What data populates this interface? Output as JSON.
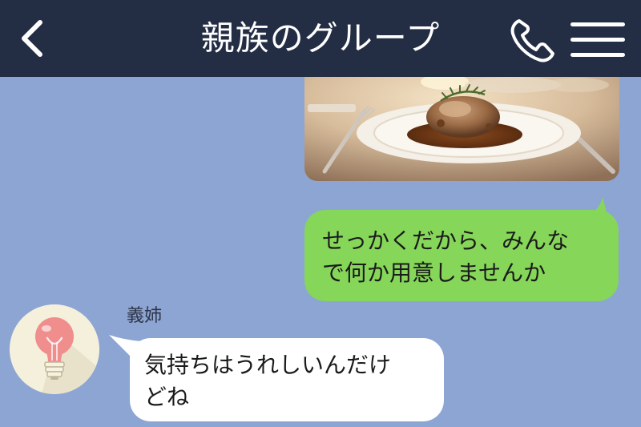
{
  "header": {
    "title": "親族のグループ",
    "background": "#232d44",
    "back_icon": "chevron-left-icon",
    "call_icon": "phone-icon",
    "menu_icon": "hamburger-menu-icon"
  },
  "chat": {
    "background": "#8da5d3",
    "messages": [
      {
        "direction": "outgoing",
        "type": "image",
        "image_content": "plated roasted chicken with rosemary on restaurant dinner table"
      },
      {
        "direction": "outgoing",
        "type": "text",
        "text": "せっかくだから、みんな\nで何か用意しませんか",
        "bubble_color": "#86d65a"
      },
      {
        "direction": "incoming",
        "type": "text",
        "sender": "義姉",
        "avatar_icon": "lightbulb-icon",
        "text": "気持ちはうれしいんだけ\nどね",
        "bubble_color": "#ffffff"
      }
    ]
  }
}
